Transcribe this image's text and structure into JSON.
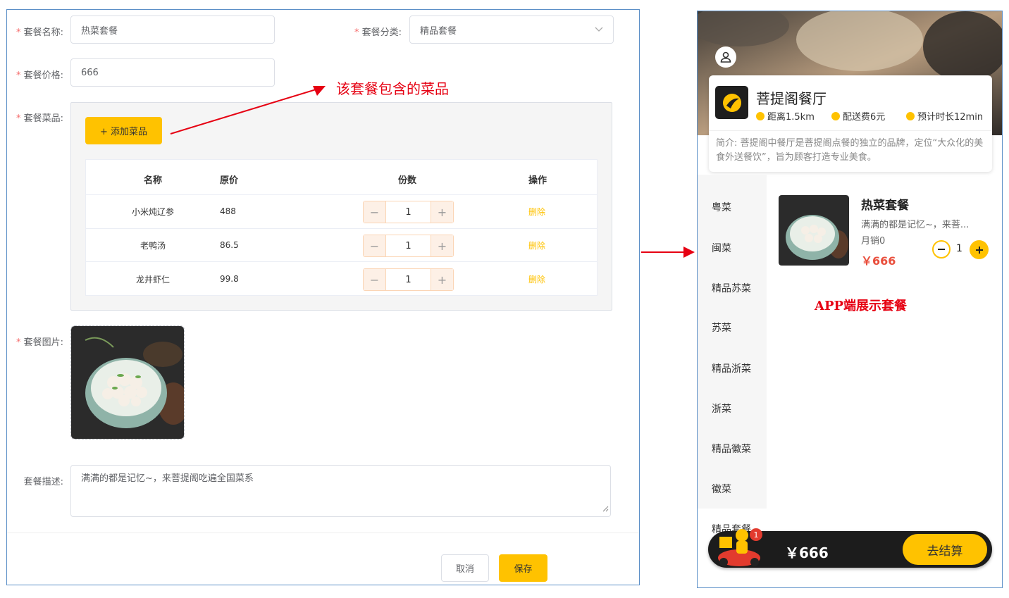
{
  "form": {
    "name_label": "套餐名称:",
    "name_value": "热菜套餐",
    "category_label": "套餐分类:",
    "category_value": "精品套餐",
    "price_label": "套餐价格:",
    "price_value": "666",
    "dishes_label": "套餐菜品:",
    "add_dish_button": "+ 添加菜品",
    "table": {
      "headers": [
        "名称",
        "原价",
        "份数",
        "操作"
      ],
      "rows": [
        {
          "name": "小米炖辽参",
          "price": "488",
          "qty": "1",
          "action": "删除"
        },
        {
          "name": "老鸭汤",
          "price": "86.5",
          "qty": "1",
          "action": "删除"
        },
        {
          "name": "龙井虾仁",
          "price": "99.8",
          "qty": "1",
          "action": "删除"
        }
      ],
      "minus": "−",
      "plus": "+"
    },
    "image_label": "套餐图片:",
    "desc_label": "套餐描述:",
    "desc_value": "满满的都是记忆~，来菩提阁吃遍全国菜系",
    "cancel_button": "取消",
    "save_button": "保存"
  },
  "annotations": {
    "dishes_note": "该套餐包含的菜品",
    "app_note": "APP端展示套餐"
  },
  "app": {
    "restaurant_name": "菩提阁餐厅",
    "distance": "距离1.5km",
    "delivery_fee": "配送费6元",
    "eta": "预计时长12min",
    "intro": "简介: 菩提阁中餐厅是菩提阁点餐的独立的品牌，定位“大众化的美食外送餐饮”，旨为顾客打造专业美食。",
    "categories": [
      "粤菜",
      "闽菜",
      "精品苏菜",
      "苏菜",
      "精品浙菜",
      "浙菜",
      "精品徽菜",
      "徽菜",
      "精品套餐"
    ],
    "item": {
      "name": "热菜套餐",
      "desc": "满满的都是记忆~，来菩...",
      "sales": "月销0",
      "price": "￥666",
      "qty": "1"
    },
    "cart": {
      "badge": "1",
      "total": "￥666",
      "checkout": "去结算"
    }
  },
  "colors": {
    "accent": "#ffc200",
    "danger": "#e60012",
    "border": "#dcdfe6"
  }
}
